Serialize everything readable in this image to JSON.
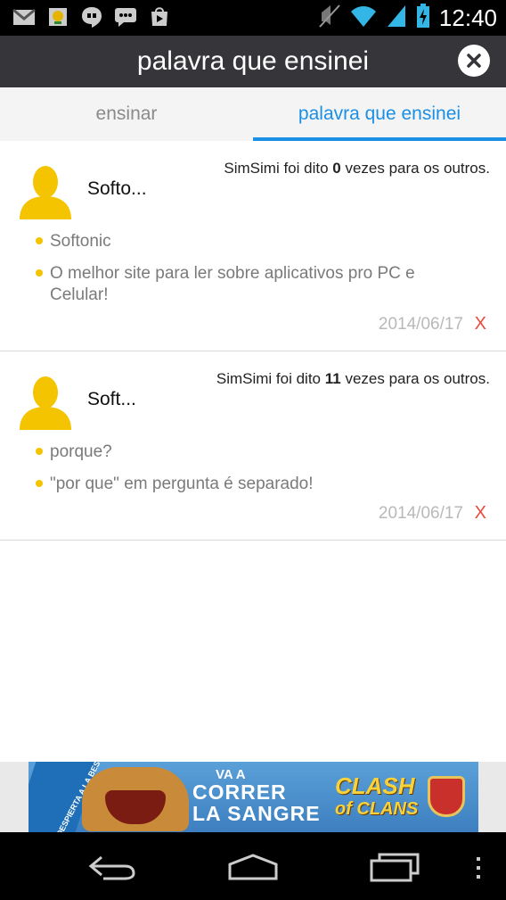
{
  "status_bar": {
    "time": "12:40",
    "left_icons": [
      "gmail-icon",
      "world-cup-icon",
      "hangouts-icon",
      "chat-icon",
      "play-store-icon"
    ],
    "right_icons": [
      "mute-icon",
      "wifi-icon",
      "signal-icon",
      "battery-icon"
    ]
  },
  "header": {
    "title": "palavra que ensinei"
  },
  "tabs": [
    {
      "label": "ensinar",
      "active": false
    },
    {
      "label": "palavra que ensinei",
      "active": true
    }
  ],
  "entries": [
    {
      "name": "Softo...",
      "said_prefix": "SimSimi foi dito ",
      "said_count": "0",
      "said_suffix": " vezes para os outros.",
      "lines": [
        "Softonic",
        "O melhor site para ler sobre aplicativos pro PC e Celular!"
      ],
      "date": "2014/06/17",
      "delete_label": "X"
    },
    {
      "name": "Soft...",
      "said_prefix": "SimSimi foi dito ",
      "said_count": "11",
      "said_suffix": " vezes para os outros.",
      "lines": [
        "porque?",
        "\"por que\" em pergunta é separado!"
      ],
      "date": "2014/06/17",
      "delete_label": "X"
    }
  ],
  "ad": {
    "stripe": "¡DESPIERTA A LA BESTIA!",
    "line1": "VA A",
    "line2": "CORRER",
    "line3": "LA SANGRE",
    "logo_line1": "CLASH",
    "logo_line2": "of CLANS"
  },
  "colors": {
    "accent": "#1a8fe6",
    "title_bar": "#35353a",
    "bullet": "#f5c400",
    "avatar": "#f5c400",
    "delete": "#e84a3a"
  }
}
